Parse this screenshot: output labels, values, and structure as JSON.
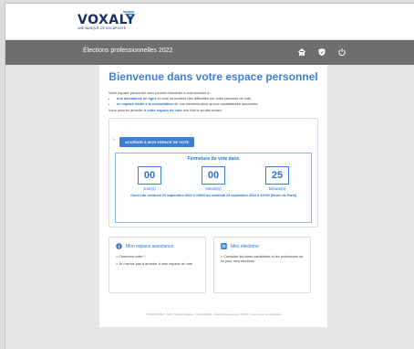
{
  "brand": {
    "name": "VOXALY",
    "tagline": "UNE MARQUE DE DOCAPOSTE"
  },
  "nav": {
    "title": "Élections professionnelles 2022",
    "icons": [
      "home-icon",
      "shield-icon",
      "power-icon"
    ]
  },
  "welcome": {
    "heading": "Bienvenue dans votre espace personnel",
    "intro": "Votre espace personnel vous permet d'accéder à tout moment à :",
    "bullet1_link": "une assistance en ligne",
    "bullet1_rest": " si vous rencontrez des difficultés sur votre parcours de vote,",
    "bullet2_link": "un espace dédié à la consultation",
    "bullet2_rest": " de vos élections ainsi qu'aux candidatures associées.",
    "outro_pre": "Vous pourrez accéder à ",
    "outro_link": "votre espace de vote",
    "outro_post": " une fois le scrutin ouvert."
  },
  "vote": {
    "button_label": "ACCÉDER À MON ESPACE DE VOTE",
    "countdown_title": "Fermeture du vote dans",
    "days_value": "00",
    "days_label": "Jour(s)",
    "hours_value": "00",
    "hours_label": "Heure(s)",
    "minutes_value": "25",
    "minutes_label": "Minute(s)",
    "period": "Ouvert du vendredi 23 septembre 2022 à 10h00 au vendredi 23 septembre 2022 à 12h00 (Heure de Paris)"
  },
  "assistance": {
    "title": "Mon espace assistance",
    "link1": "> Comment voter ?",
    "link2": "> Je n'arrive pas à accéder à mon espace de vote"
  },
  "elections": {
    "title": "Mes élections",
    "link1": "> Consulter les listes candidates et les professions de foi pour mes élections"
  },
  "footer": {
    "text": "© 2022 VOXALY · FAQ · Mentions légales · Confidentialité · Solution proposée par VOXALY, une marque de Docaposte"
  },
  "colors": {
    "accent": "#3d7fd6",
    "navbar": "#6e6e6e",
    "brand": "#1c2f63"
  }
}
